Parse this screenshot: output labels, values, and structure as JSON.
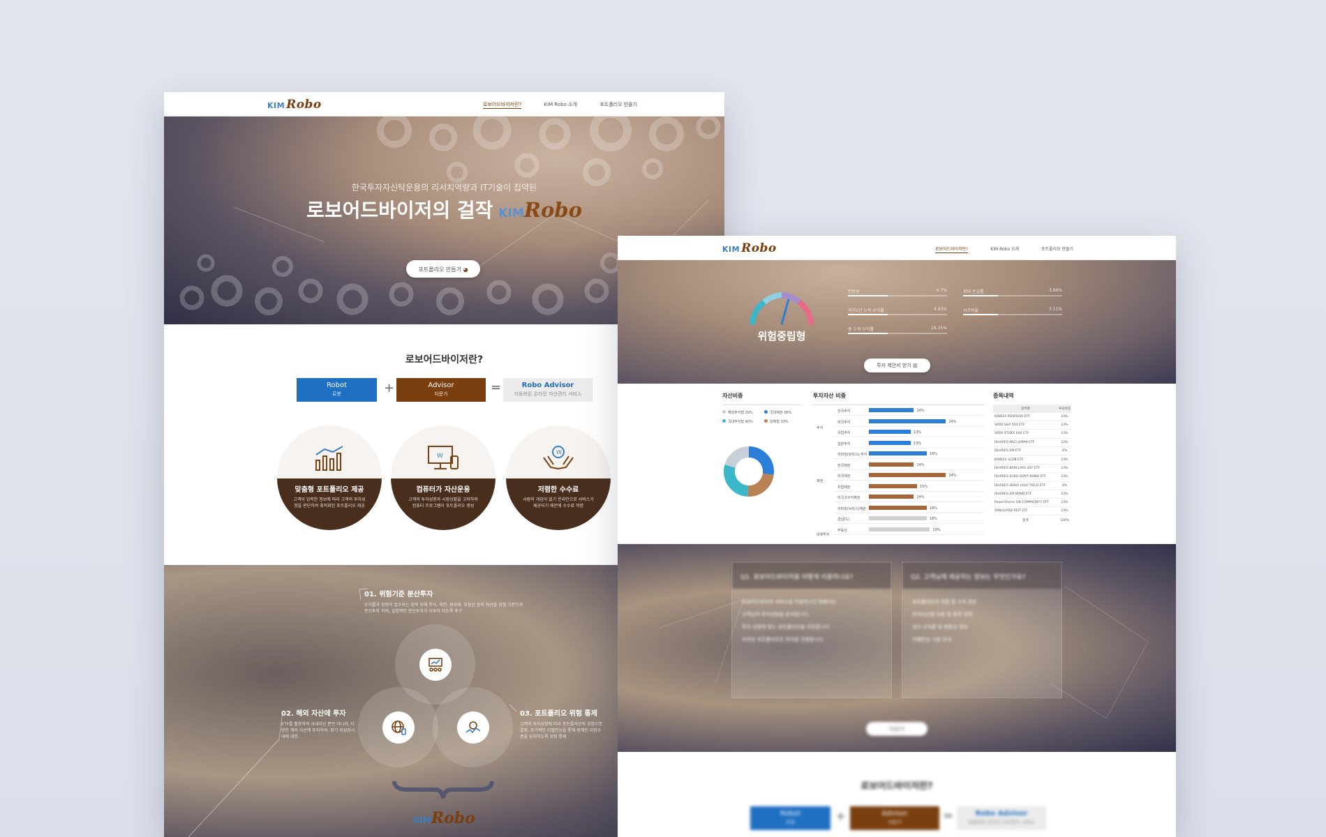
{
  "brand": {
    "kim": "KIM",
    "robo": "Robo"
  },
  "nav": {
    "items": [
      "로보어드바이저란?",
      "KIM Robo 소개",
      "포트폴리오 만들기"
    ]
  },
  "hero": {
    "subtitle": "한국투자자신탁운용의 리서치역량과 IT기술이 집약된",
    "title": "로보어드바이저의 걸작",
    "cta": "포트폴리오 만들기"
  },
  "about": {
    "title": "로보어드바이저란?",
    "robot": {
      "label": "Robot",
      "sub": "로봇"
    },
    "advisor": {
      "label": "Advisor",
      "sub": "자문가"
    },
    "result": {
      "label": "Robo Advisor",
      "sub": "자동화된 온라인 자산관리 서비스"
    },
    "features": [
      {
        "title": "맞춤형 포트폴리오 제공",
        "desc": "고객이 입력한 정보에 따라 고객의 투자성향을 판단하여 최적화된 포트폴리오 제공"
      },
      {
        "title": "컴퓨터가 자산운용",
        "desc": "고객의 투자성향과 시장상황을 고려하여 컴퓨터 프로그램이 포트폴리오 생성"
      },
      {
        "title": "저렴한 수수료",
        "desc": "사람의 개입이 없기 온라인으로 서비스가 제공되기 때문에 수수료 저렴"
      }
    ]
  },
  "strengths": [
    {
      "title": "01. 위험기준 분산투자",
      "desc": "수익률과 위험의 합수라는 정적 위해 주식, 채권, 원자재, 부동산 등의 자산들 위험 기준으로 분산투자 하여, 설정적인 분산투자가 이루어 지도록 추구"
    },
    {
      "title": "02. 해외 자산에 투자",
      "desc": "ETF를 활용하여 국내자산 뿐만 아니라, 다양한 해외 자산에 투자하여, 장기 저성장시대에 대응."
    },
    {
      "title": "03. 포트폴리오 위험 통제",
      "desc": "고객의 투자성향에 따라 포트폴리오의 위험수준 결정, 주기적인 리밸런싱을 통해 정해진 위험수준을 유지하도록 위험 통제"
    }
  ],
  "result": {
    "risk_label": "위험중립형",
    "metrics": [
      {
        "label": "변동성",
        "value": "6.7%",
        "level": 0.4
      },
      {
        "label": "최대 손실률",
        "value": "3.96%",
        "level": 0.35
      },
      {
        "label": "과거1년 누적 수익률",
        "value": "4.63%",
        "level": 0.4
      },
      {
        "label": "샤프비율",
        "value": "3.11%",
        "level": 0.35
      },
      {
        "label": "총 누적 수익률",
        "value": "16.35%",
        "level": 0.4
      }
    ],
    "cta": "투자 제안서 받기",
    "alloc_title": "자산비중",
    "legend": [
      {
        "name": "해외주식형",
        "value": "29%",
        "color": "#c9cfd8"
      },
      {
        "name": "국내채권",
        "value": "38%",
        "color": "#2b7fd8"
      },
      {
        "name": "국내주식형",
        "value": "40%",
        "color": "#3cb6c9"
      },
      {
        "name": "대체형",
        "value": "33%",
        "color": "#b88254"
      }
    ],
    "weights_title": "투자자산 비중",
    "weights": [
      {
        "group": "주식",
        "name": "한국주식",
        "value": "14%",
        "v": 14,
        "color": "#2b7fd8"
      },
      {
        "group": "",
        "name": "미국주식",
        "value": "24%",
        "v": 24,
        "color": "#2b7fd8"
      },
      {
        "group": "",
        "name": "유럽주식",
        "value": "13%",
        "v": 13,
        "color": "#2b7fd8"
      },
      {
        "group": "",
        "name": "일본주식",
        "value": "13%",
        "v": 13,
        "color": "#2b7fd8"
      },
      {
        "group": "",
        "name": "이머징(브릭스) 주식",
        "value": "18%",
        "v": 18,
        "color": "#2b7fd8"
      },
      {
        "group": "채권",
        "name": "한국채권",
        "value": "14%",
        "v": 14,
        "color": "#a5643a"
      },
      {
        "group": "",
        "name": "미국채권",
        "value": "24%",
        "v": 24,
        "color": "#a5643a"
      },
      {
        "group": "",
        "name": "유럽채권",
        "value": "15%",
        "v": 15,
        "color": "#a5643a"
      },
      {
        "group": "",
        "name": "미국고수익채권",
        "value": "14%",
        "v": 14,
        "color": "#a5643a"
      },
      {
        "group": "",
        "name": "이머징(브릭스)채권",
        "value": "18%",
        "v": 18,
        "color": "#a5643a"
      },
      {
        "group": "대체투자",
        "name": "금(골드)",
        "value": "18%",
        "v": 18,
        "color": "#d2d2d2"
      },
      {
        "group": "",
        "name": "부동산",
        "value": "19%",
        "v": 19,
        "color": "#d2d2d2"
      }
    ],
    "holdings_title": "종목내역",
    "holdings_header": [
      "종목명",
      "투자비중"
    ],
    "holdings": [
      [
        "KINDEX KOSPI200 ETF",
        "24%"
      ],
      [
        "SPDR S&P 500 ETF",
        "23%"
      ],
      [
        "SPDR STOXX 600 ETF",
        "23%"
      ],
      [
        "ISHARES MSCI JAPAN ETF",
        "22%"
      ],
      [
        "ISHARES EM ETF",
        "4%"
      ],
      [
        "KINDEX 국고채 ETF",
        "23%"
      ],
      [
        "ISHARES BARCLAYS 20Y ETF",
        "23%"
      ],
      [
        "ISHARES EURO GOVT BOND ETF",
        "23%"
      ],
      [
        "ISHARES iBOXX HIGH YIELD ETF",
        "4%"
      ],
      [
        "ISHARES EM BOND ETF",
        "23%"
      ],
      [
        "PowerShares DB COMMODITY ETF",
        "23%"
      ],
      [
        "VANGUARD REIT ETF",
        "23%"
      ]
    ],
    "holdings_total": [
      "합계",
      "100%"
    ]
  },
  "qa": {
    "cards": [
      {
        "title": "Q1. 로보어드바이저를 어떻게 이용하나요?",
        "lines": [
          "로보어드바이저 서비스를 이용하시기 위해서는",
          "고객님의 투자성향을 분석합니다.",
          "투자 성향에 맞는 포트폴리오를 추천합니다.",
          "추천된 포트폴리오로 투자를 진행합니다."
        ]
      },
      {
        "title": "Q2. 고객님께 제공하는 정보는 무엇인가요?",
        "lines": [
          "포트폴리오의 위험 및 수익 정보",
          "투자자산별 비중 및 종목 내역",
          "과거 수익률 및 변동성 정보",
          "리밸런싱 시점 안내"
        ]
      }
    ],
    "more": "더보기"
  },
  "bottom": {
    "title": "로보어드바이저란?"
  },
  "colors": {
    "accent": "#7a3f0e",
    "blue": "#1f6fc2",
    "brown": "#7a3f0e",
    "dark_brown": "#4a2e1d"
  }
}
